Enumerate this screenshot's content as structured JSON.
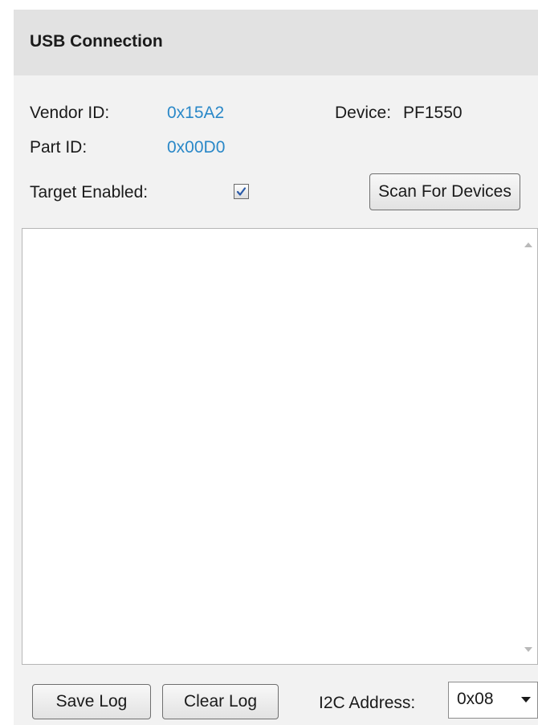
{
  "header": {
    "title": "USB Connection"
  },
  "info": {
    "vendor_label": "Vendor ID:",
    "vendor_value": "0x15A2",
    "part_label": "Part ID:",
    "part_value": "0x00D0",
    "device_label": "Device:",
    "device_value": "PF1550",
    "value_color": "#2a88c8"
  },
  "target": {
    "label": "Target Enabled:",
    "checked": true
  },
  "scan_button": "Scan For Devices",
  "log": {
    "content": ""
  },
  "footer": {
    "save_button": "Save Log",
    "clear_button": "Clear Log",
    "address_label": "I2C Address:",
    "address_value": "0x08"
  },
  "icons": {
    "checkbox": "checkmark-icon",
    "scroll_up": "scroll-up-arrow-icon",
    "scroll_down": "scroll-down-arrow-icon",
    "dropdown": "chevron-down-icon"
  }
}
